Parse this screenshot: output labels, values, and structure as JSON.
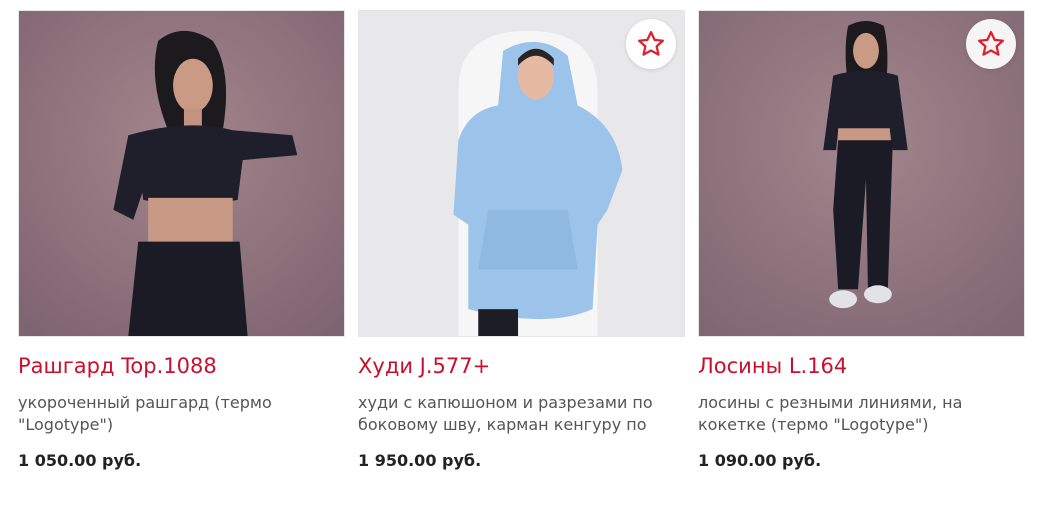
{
  "products": [
    {
      "title": "Рашгард Top.1088",
      "description": "укороченный рашгард (термо \"Logotype\")",
      "price": "1 050.00 руб.",
      "favorite_icon": null,
      "image_bg": "#8c6f78"
    },
    {
      "title": "Худи J.577+",
      "description": "худи с капюшоном и разрезами по боковому шву, карман кенгуру по",
      "price": "1 950.00 руб.",
      "favorite_icon": "star-outline-icon",
      "image_bg": "#e9e9eb"
    },
    {
      "title": "Лосины L.164",
      "description": "лосины с резными линиями, на кокетке (термо \"Logotype\")",
      "price": "1 090.00 руб.",
      "favorite_icon": "star-outline-icon",
      "image_bg": "#8e727a"
    }
  ],
  "colors": {
    "title": "#c8102e",
    "star": "#d9232d",
    "price": "#222222",
    "description": "#555555"
  }
}
